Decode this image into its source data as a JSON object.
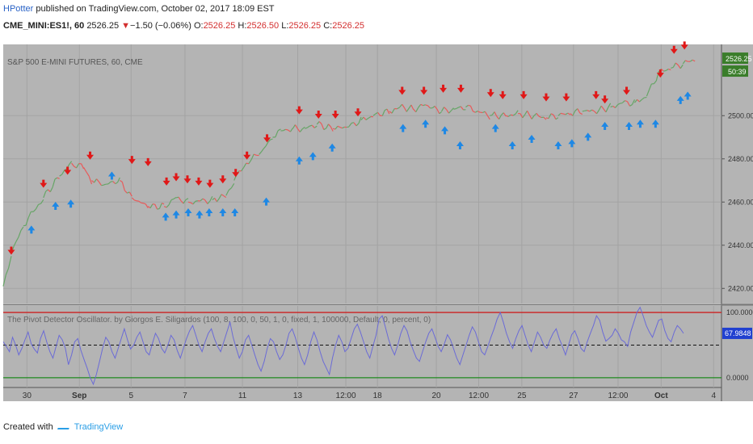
{
  "header": {
    "author": "HPotter",
    "published": "published on TradingView.com, October 02, 2017 18:09 EST",
    "symbol": "CME_MINI:ES1!, 60",
    "last": "2526.25",
    "change_arrow": "▼",
    "change": "−1.50 (−0.06%)",
    "o_label": "O:",
    "o": "2526.25",
    "h_label": "H:",
    "h": "2526.50",
    "l_label": "L:",
    "l": "2526.25",
    "c_label": "C:",
    "c": "2526.25"
  },
  "footer": {
    "created_with": "Created with",
    "brand": "TradingView"
  },
  "chart_data": [
    {
      "type": "line",
      "title": "S&P 500 E-MINI FUTURES, 60, CME",
      "ylim": [
        2413,
        2533
      ],
      "y_ticks": [
        2420,
        2440,
        2460,
        2480,
        2500
      ],
      "y_tick_labels": [
        "2420.00",
        "2440.00",
        "2460.00",
        "2480.00",
        "2500.00"
      ],
      "price_label": "2526.25",
      "countdown_label": "50:39",
      "x_ticks": [
        "30",
        "Sep",
        "5",
        "7",
        "11",
        "13",
        "12:00",
        "18",
        "20",
        "12:00",
        "25",
        "27",
        "12:00",
        "Oct",
        "4"
      ],
      "price_path": [
        [
          0,
          2421
        ],
        [
          10,
          2436
        ],
        [
          25,
          2449
        ],
        [
          50,
          2462
        ],
        [
          70,
          2472
        ],
        [
          85,
          2478
        ],
        [
          100,
          2476
        ],
        [
          110,
          2470
        ],
        [
          125,
          2468
        ],
        [
          145,
          2470
        ],
        [
          160,
          2462
        ],
        [
          180,
          2458
        ],
        [
          200,
          2458
        ],
        [
          215,
          2462
        ],
        [
          230,
          2460
        ],
        [
          260,
          2461
        ],
        [
          277,
          2463
        ],
        [
          287,
          2470
        ],
        [
          302,
          2478
        ],
        [
          318,
          2482
        ],
        [
          335,
          2490
        ],
        [
          345,
          2493
        ],
        [
          360,
          2494
        ],
        [
          375,
          2494
        ],
        [
          390,
          2496
        ],
        [
          410,
          2494
        ],
        [
          430,
          2495
        ],
        [
          445,
          2498
        ],
        [
          460,
          2500
        ],
        [
          480,
          2502
        ],
        [
          493,
          2504
        ],
        [
          510,
          2503
        ],
        [
          525,
          2505
        ],
        [
          545,
          2502
        ],
        [
          560,
          2503
        ],
        [
          575,
          2504
        ],
        [
          590,
          2502
        ],
        [
          605,
          2500
        ],
        [
          625,
          2500
        ],
        [
          640,
          2501
        ],
        [
          660,
          2500
        ],
        [
          675,
          2499
        ],
        [
          690,
          2500
        ],
        [
          705,
          2501
        ],
        [
          720,
          2502
        ],
        [
          735,
          2502
        ],
        [
          755,
          2504
        ],
        [
          770,
          2506
        ],
        [
          785,
          2506
        ],
        [
          800,
          2509
        ],
        [
          815,
          2520
        ],
        [
          830,
          2522
        ],
        [
          845,
          2524
        ],
        [
          860,
          2526
        ]
      ],
      "sell_signals": [
        [
          10,
          2433
        ],
        [
          50,
          2464
        ],
        [
          80,
          2470
        ],
        [
          108,
          2477
        ],
        [
          160,
          2475
        ],
        [
          180,
          2474
        ],
        [
          203,
          2465
        ],
        [
          215,
          2467
        ],
        [
          229,
          2466
        ],
        [
          243,
          2465
        ],
        [
          257,
          2464
        ],
        [
          273,
          2466
        ],
        [
          289,
          2469
        ],
        [
          303,
          2477
        ],
        [
          328,
          2485
        ],
        [
          368,
          2498
        ],
        [
          392,
          2496
        ],
        [
          413,
          2496
        ],
        [
          441,
          2497
        ],
        [
          496,
          2507
        ],
        [
          523,
          2507
        ],
        [
          547,
          2508
        ],
        [
          569,
          2508
        ],
        [
          606,
          2506
        ],
        [
          621,
          2505
        ],
        [
          647,
          2505
        ],
        [
          675,
          2504
        ],
        [
          700,
          2504
        ],
        [
          737,
          2505
        ],
        [
          748,
          2503
        ],
        [
          775,
          2507
        ],
        [
          817,
          2515
        ],
        [
          834,
          2526
        ],
        [
          847,
          2528
        ]
      ],
      "buy_signals": [
        [
          35,
          2448
        ],
        [
          65,
          2459
        ],
        [
          84,
          2460
        ],
        [
          135,
          2473
        ],
        [
          202,
          2454
        ],
        [
          215,
          2455
        ],
        [
          230,
          2456
        ],
        [
          244,
          2455
        ],
        [
          256,
          2456
        ],
        [
          273,
          2456
        ],
        [
          288,
          2456
        ],
        [
          327,
          2461
        ],
        [
          368,
          2480
        ],
        [
          385,
          2482
        ],
        [
          409,
          2486
        ],
        [
          497,
          2495
        ],
        [
          525,
          2497
        ],
        [
          549,
          2494
        ],
        [
          568,
          2487
        ],
        [
          612,
          2495
        ],
        [
          633,
          2487
        ],
        [
          657,
          2490
        ],
        [
          690,
          2487
        ],
        [
          707,
          2488
        ],
        [
          727,
          2491
        ],
        [
          748,
          2496
        ],
        [
          778,
          2496
        ],
        [
          792,
          2497
        ],
        [
          811,
          2497
        ],
        [
          842,
          2508
        ],
        [
          851,
          2510
        ]
      ]
    },
    {
      "type": "line",
      "title": "The Pivot Detector Oscillator. by Giorgos E. Siligardos (100, 8, 100, 0, 50, 1, 0, fixed, 1, 100000, Default, 0, percent, 0)",
      "ylim": [
        -15,
        110
      ],
      "upper_level": 100,
      "lower_level": 0,
      "mid_level": 50,
      "y_tick_labels": [
        "100.0000",
        "0.0000"
      ],
      "value_label": "67.9848",
      "series_color": "#6b6bd6",
      "values": [
        55,
        48,
        40,
        62,
        50,
        35,
        45,
        58,
        70,
        52,
        44,
        38,
        60,
        72,
        55,
        40,
        30,
        48,
        65,
        58,
        45,
        20,
        35,
        55,
        60,
        42,
        28,
        15,
        0,
        -10,
        5,
        25,
        45,
        62,
        55,
        40,
        30,
        45,
        60,
        75,
        58,
        44,
        50,
        62,
        70,
        55,
        40,
        35,
        52,
        68,
        60,
        45,
        38,
        50,
        65,
        58,
        42,
        30,
        45,
        60,
        72,
        80,
        65,
        50,
        40,
        55,
        68,
        75,
        60,
        48,
        40,
        55,
        70,
        85,
        62,
        45,
        30,
        40,
        58,
        65,
        50,
        35,
        20,
        10,
        25,
        45,
        60,
        55,
        40,
        28,
        35,
        50,
        68,
        75,
        62,
        45,
        30,
        20,
        35,
        55,
        70,
        58,
        40,
        25,
        15,
        5,
        30,
        50,
        65,
        55,
        40,
        45,
        60,
        75,
        82,
        70,
        55,
        40,
        30,
        48,
        65,
        90,
        95,
        78,
        60,
        45,
        35,
        50,
        68,
        80,
        72,
        55,
        42,
        30,
        25,
        40,
        55,
        68,
        75,
        62,
        48,
        40,
        52,
        66,
        58,
        44,
        30,
        20,
        35,
        50,
        65,
        78,
        70,
        55,
        40,
        35,
        48,
        62,
        75,
        90,
        100,
        85,
        68,
        55,
        45,
        60,
        72,
        80,
        65,
        50,
        40,
        55,
        70,
        62,
        50,
        45,
        58,
        68,
        75,
        60,
        48,
        35,
        50,
        66,
        72,
        60,
        45,
        40,
        55,
        68,
        80,
        95,
        88,
        70,
        56,
        60,
        65,
        75,
        68,
        58,
        55,
        48,
        70,
        85,
        100,
        108,
        95,
        80,
        70,
        62,
        75,
        88,
        90,
        72,
        60,
        55,
        70,
        80,
        75,
        68
      ]
    }
  ]
}
